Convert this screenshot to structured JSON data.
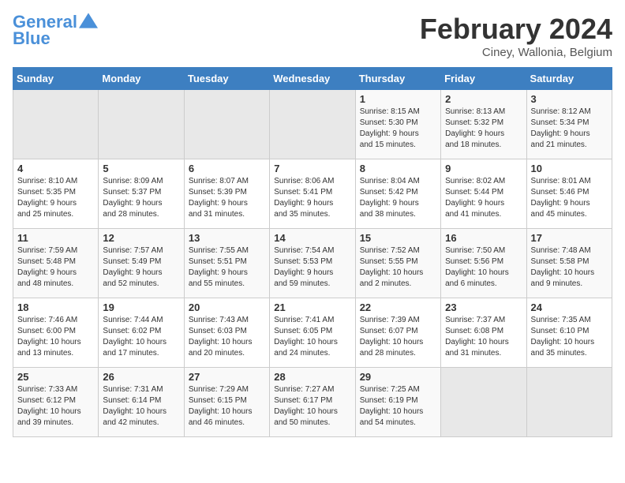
{
  "logo": {
    "line1": "General",
    "line2": "Blue"
  },
  "title": "February 2024",
  "subtitle": "Ciney, Wallonia, Belgium",
  "days_of_week": [
    "Sunday",
    "Monday",
    "Tuesday",
    "Wednesday",
    "Thursday",
    "Friday",
    "Saturday"
  ],
  "weeks": [
    [
      {
        "day": "",
        "info": ""
      },
      {
        "day": "",
        "info": ""
      },
      {
        "day": "",
        "info": ""
      },
      {
        "day": "",
        "info": ""
      },
      {
        "day": "1",
        "info": "Sunrise: 8:15 AM\nSunset: 5:30 PM\nDaylight: 9 hours\nand 15 minutes."
      },
      {
        "day": "2",
        "info": "Sunrise: 8:13 AM\nSunset: 5:32 PM\nDaylight: 9 hours\nand 18 minutes."
      },
      {
        "day": "3",
        "info": "Sunrise: 8:12 AM\nSunset: 5:34 PM\nDaylight: 9 hours\nand 21 minutes."
      }
    ],
    [
      {
        "day": "4",
        "info": "Sunrise: 8:10 AM\nSunset: 5:35 PM\nDaylight: 9 hours\nand 25 minutes."
      },
      {
        "day": "5",
        "info": "Sunrise: 8:09 AM\nSunset: 5:37 PM\nDaylight: 9 hours\nand 28 minutes."
      },
      {
        "day": "6",
        "info": "Sunrise: 8:07 AM\nSunset: 5:39 PM\nDaylight: 9 hours\nand 31 minutes."
      },
      {
        "day": "7",
        "info": "Sunrise: 8:06 AM\nSunset: 5:41 PM\nDaylight: 9 hours\nand 35 minutes."
      },
      {
        "day": "8",
        "info": "Sunrise: 8:04 AM\nSunset: 5:42 PM\nDaylight: 9 hours\nand 38 minutes."
      },
      {
        "day": "9",
        "info": "Sunrise: 8:02 AM\nSunset: 5:44 PM\nDaylight: 9 hours\nand 41 minutes."
      },
      {
        "day": "10",
        "info": "Sunrise: 8:01 AM\nSunset: 5:46 PM\nDaylight: 9 hours\nand 45 minutes."
      }
    ],
    [
      {
        "day": "11",
        "info": "Sunrise: 7:59 AM\nSunset: 5:48 PM\nDaylight: 9 hours\nand 48 minutes."
      },
      {
        "day": "12",
        "info": "Sunrise: 7:57 AM\nSunset: 5:49 PM\nDaylight: 9 hours\nand 52 minutes."
      },
      {
        "day": "13",
        "info": "Sunrise: 7:55 AM\nSunset: 5:51 PM\nDaylight: 9 hours\nand 55 minutes."
      },
      {
        "day": "14",
        "info": "Sunrise: 7:54 AM\nSunset: 5:53 PM\nDaylight: 9 hours\nand 59 minutes."
      },
      {
        "day": "15",
        "info": "Sunrise: 7:52 AM\nSunset: 5:55 PM\nDaylight: 10 hours\nand 2 minutes."
      },
      {
        "day": "16",
        "info": "Sunrise: 7:50 AM\nSunset: 5:56 PM\nDaylight: 10 hours\nand 6 minutes."
      },
      {
        "day": "17",
        "info": "Sunrise: 7:48 AM\nSunset: 5:58 PM\nDaylight: 10 hours\nand 9 minutes."
      }
    ],
    [
      {
        "day": "18",
        "info": "Sunrise: 7:46 AM\nSunset: 6:00 PM\nDaylight: 10 hours\nand 13 minutes."
      },
      {
        "day": "19",
        "info": "Sunrise: 7:44 AM\nSunset: 6:02 PM\nDaylight: 10 hours\nand 17 minutes."
      },
      {
        "day": "20",
        "info": "Sunrise: 7:43 AM\nSunset: 6:03 PM\nDaylight: 10 hours\nand 20 minutes."
      },
      {
        "day": "21",
        "info": "Sunrise: 7:41 AM\nSunset: 6:05 PM\nDaylight: 10 hours\nand 24 minutes."
      },
      {
        "day": "22",
        "info": "Sunrise: 7:39 AM\nSunset: 6:07 PM\nDaylight: 10 hours\nand 28 minutes."
      },
      {
        "day": "23",
        "info": "Sunrise: 7:37 AM\nSunset: 6:08 PM\nDaylight: 10 hours\nand 31 minutes."
      },
      {
        "day": "24",
        "info": "Sunrise: 7:35 AM\nSunset: 6:10 PM\nDaylight: 10 hours\nand 35 minutes."
      }
    ],
    [
      {
        "day": "25",
        "info": "Sunrise: 7:33 AM\nSunset: 6:12 PM\nDaylight: 10 hours\nand 39 minutes."
      },
      {
        "day": "26",
        "info": "Sunrise: 7:31 AM\nSunset: 6:14 PM\nDaylight: 10 hours\nand 42 minutes."
      },
      {
        "day": "27",
        "info": "Sunrise: 7:29 AM\nSunset: 6:15 PM\nDaylight: 10 hours\nand 46 minutes."
      },
      {
        "day": "28",
        "info": "Sunrise: 7:27 AM\nSunset: 6:17 PM\nDaylight: 10 hours\nand 50 minutes."
      },
      {
        "day": "29",
        "info": "Sunrise: 7:25 AM\nSunset: 6:19 PM\nDaylight: 10 hours\nand 54 minutes."
      },
      {
        "day": "",
        "info": ""
      },
      {
        "day": "",
        "info": ""
      }
    ]
  ]
}
